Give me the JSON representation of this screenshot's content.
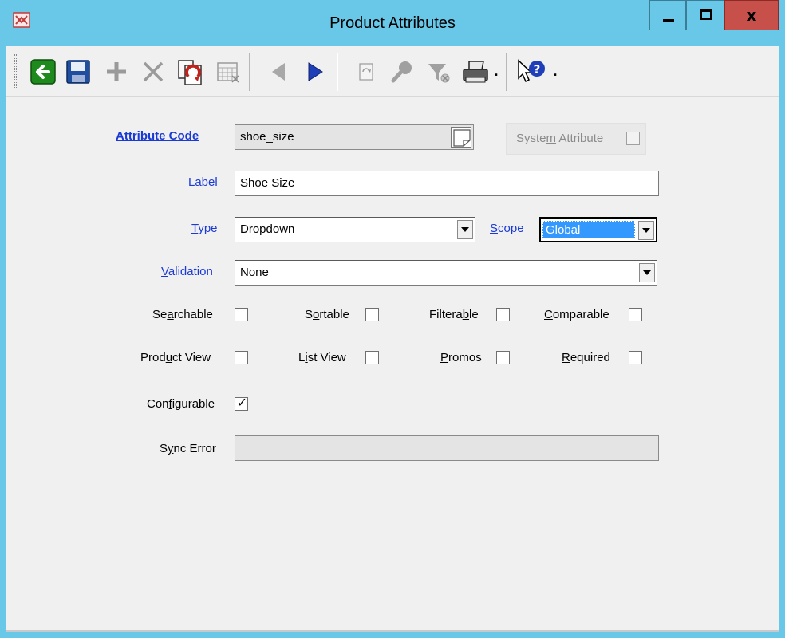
{
  "window": {
    "title": "Product Attributes",
    "close_glyph": "x",
    "icon": "app-logo-icon"
  },
  "toolbar": {
    "buttons": [
      {
        "name": "back-button",
        "icon": "back-arrow-icon"
      },
      {
        "name": "save-button",
        "icon": "floppy-disk-icon"
      },
      {
        "name": "add-button",
        "icon": "plus-icon"
      },
      {
        "name": "delete-button",
        "icon": "x-icon"
      },
      {
        "name": "copy-button",
        "icon": "copy-document-icon"
      },
      {
        "name": "calendar-button",
        "icon": "calendar-grid-icon"
      },
      {
        "name": "previous-button",
        "icon": "triangle-left-icon"
      },
      {
        "name": "next-button",
        "icon": "triangle-right-icon"
      },
      {
        "name": "refresh-button",
        "icon": "refresh-document-icon"
      },
      {
        "name": "find-button",
        "icon": "magnifier-icon"
      },
      {
        "name": "filter-button",
        "icon": "funnel-icon"
      },
      {
        "name": "print-button",
        "icon": "printer-icon"
      },
      {
        "name": "help-button",
        "icon": "help-pointer-icon"
      }
    ],
    "dropdown_glyph": "▪"
  },
  "form": {
    "attribute_code": {
      "label": "Attribute Code",
      "value": "shoe_size"
    },
    "system_attribute": {
      "label_pre": "Syste",
      "label_u": "m",
      "label_post": " Attribute",
      "checked": false
    },
    "label": {
      "label_u": "L",
      "label_post": "abel",
      "value": "Shoe Size"
    },
    "type": {
      "label_u": "T",
      "label_post": "ype",
      "value": "Dropdown"
    },
    "scope": {
      "label_u": "S",
      "label_post": "cope",
      "value": "Global"
    },
    "validation": {
      "label_u": "V",
      "label_post": "alidation",
      "value": "None"
    },
    "checkboxes": {
      "searchable": {
        "pre": "Se",
        "u": "a",
        "post": "rchable",
        "checked": false
      },
      "sortable": {
        "pre": "S",
        "u": "o",
        "post": "rtable",
        "checked": false
      },
      "filterable": {
        "pre": "Filtera",
        "u": "b",
        "post": "le",
        "checked": false
      },
      "comparable": {
        "pre": "",
        "u": "C",
        "post": "omparable",
        "checked": false
      },
      "product_view": {
        "pre": "Prod",
        "u": "u",
        "post": "ct View",
        "checked": false
      },
      "list_view": {
        "pre": "L",
        "u": "i",
        "post": "st View",
        "checked": false
      },
      "promos": {
        "pre": "",
        "u": "P",
        "post": "romos",
        "checked": false
      },
      "required": {
        "pre": "",
        "u": "R",
        "post": "equired",
        "checked": false
      },
      "configurable": {
        "pre": "Con",
        "u": "f",
        "post": "igurable",
        "checked": true
      }
    },
    "sync_error": {
      "pre": "S",
      "u": "y",
      "post": "nc Error",
      "value": ""
    },
    "check_glyph": "✓"
  }
}
